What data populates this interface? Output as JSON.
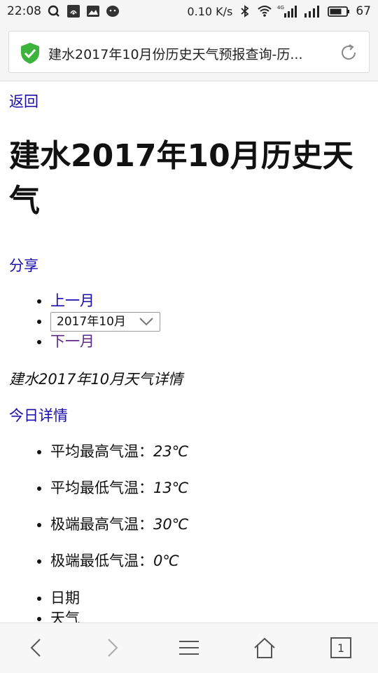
{
  "status_bar": {
    "time": "22:08",
    "net_speed": "0.10 K/s",
    "signal_4g": "4G",
    "battery": "67"
  },
  "address_bar": {
    "title": "建水2017年10月份历史天气预报查询-历..."
  },
  "page": {
    "back_label": "返回",
    "title": "建水2017年10月历史天气",
    "share_label": "分享",
    "prev_month_label": "上一月",
    "month_select_value": "2017年10月",
    "next_month_label": "下一月",
    "detail_heading": "建水2017年10月天气详情",
    "today_label": "今日详情",
    "stats": [
      {
        "label": "平均最高气温：",
        "value": "23℃"
      },
      {
        "label": "平均最低气温：",
        "value": "13℃"
      },
      {
        "label": "极端最高气温：",
        "value": "30℃"
      },
      {
        "label": "极端最低气温：",
        "value": "0℃"
      }
    ],
    "table_headers": [
      "日期",
      "天气"
    ]
  },
  "toolbar": {
    "tab_count": "1"
  },
  "colors": {
    "link": "#1a0dab",
    "visited_link": "#5b2a86",
    "shield": "#3cb43c"
  }
}
